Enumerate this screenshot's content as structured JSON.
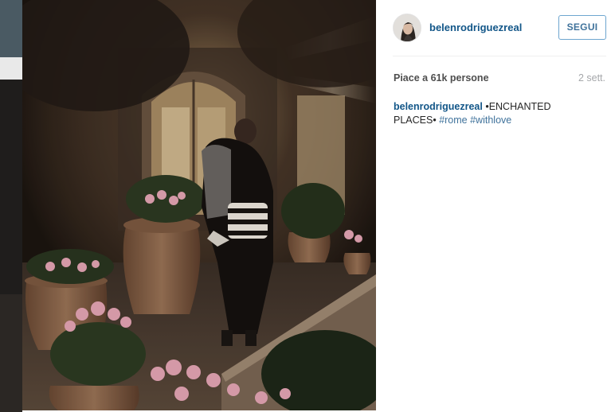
{
  "post": {
    "username": "belenrodriguezreal",
    "follow_label": "SEGUI",
    "likes": "Piace a 61k persone",
    "time": "2 sett.",
    "caption": {
      "username": "belenrodriguezreal",
      "text": " •ENCHANTED PLACES• ",
      "hashtags": [
        "#rome",
        "#withlove"
      ]
    }
  },
  "colors": {
    "username": "#125688",
    "hashtag": "#3f729b",
    "follow_border": "#6ea6cf",
    "muted": "#a5a7aa"
  },
  "icons": {
    "avatar": "profile-avatar",
    "photo": "post-photo"
  }
}
